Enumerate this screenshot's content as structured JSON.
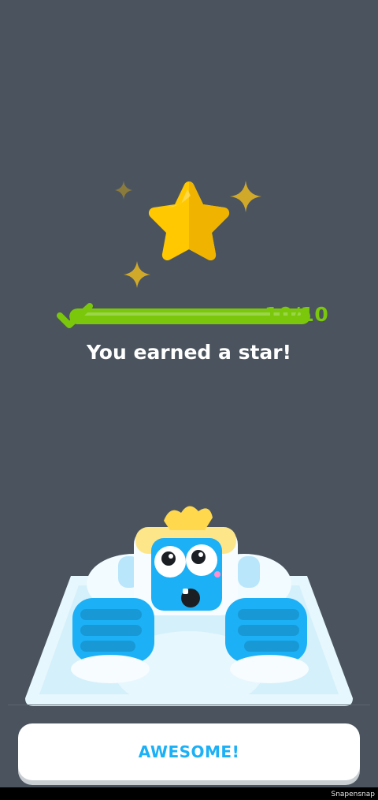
{
  "reward": {
    "icon": "star-icon",
    "headline": "You earned a star!",
    "progress": {
      "label": "10/10",
      "current": 10,
      "total": 10,
      "fraction": 1.0
    }
  },
  "actions": {
    "primary_label": "AWESOME!"
  },
  "watermark": {
    "text": "Snapensnap"
  },
  "colors": {
    "background": "#4b545e",
    "progress_green": "#7ac70c",
    "star_gold": "#ffc800",
    "button_text_blue": "#1cb0f6",
    "mascot_blue": "#1cb0f6"
  }
}
